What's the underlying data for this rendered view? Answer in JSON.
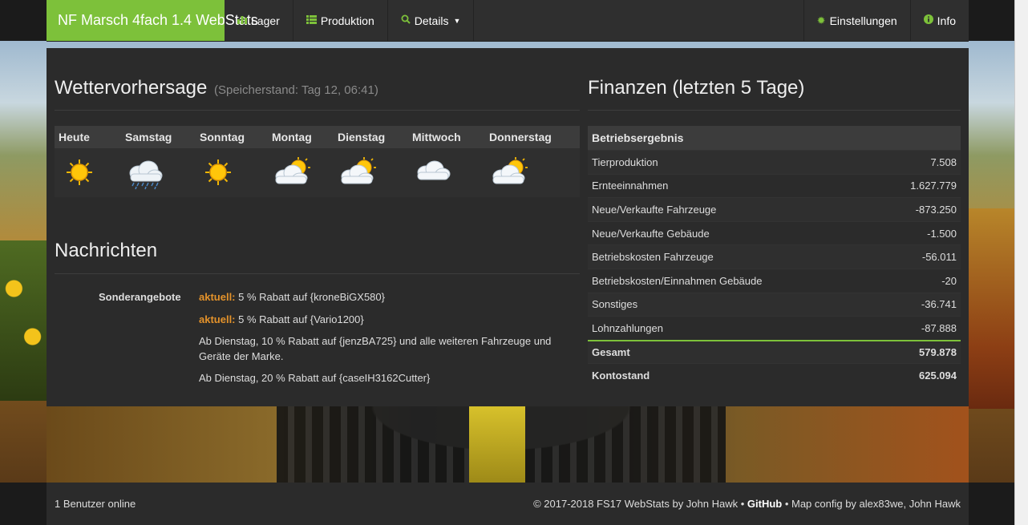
{
  "nav": {
    "brand": "NF Marsch 4fach 1.4 WebStats",
    "items": [
      {
        "label": "Lager",
        "icon": "bar-chart-icon"
      },
      {
        "label": "Produktion",
        "icon": "list-icon"
      },
      {
        "label": "Details",
        "icon": "search-icon"
      }
    ],
    "right": [
      {
        "label": "Einstellungen",
        "icon": "gear-icon"
      },
      {
        "label": "Info",
        "icon": "info-icon"
      }
    ]
  },
  "weather": {
    "title": "Wettervorhersage",
    "subtitle": "(Speicherstand: Tag 12, 06:41)",
    "days": [
      {
        "label": "Heute",
        "icon": "sun-icon"
      },
      {
        "label": "Samstag",
        "icon": "rain-icon"
      },
      {
        "label": "Sonntag",
        "icon": "sun-icon"
      },
      {
        "label": "Montag",
        "icon": "partly-cloudy-icon"
      },
      {
        "label": "Dienstag",
        "icon": "partly-cloudy-icon"
      },
      {
        "label": "Mittwoch",
        "icon": "cloud-icon"
      },
      {
        "label": "Donnerstag",
        "icon": "partly-cloudy-icon"
      }
    ]
  },
  "news": {
    "title": "Nachrichten",
    "label": "Sonderangebote",
    "items": [
      {
        "prefix": "aktuell:",
        "text": " 5 % Rabatt auf {kroneBiGX580}"
      },
      {
        "prefix": "aktuell:",
        "text": " 5 % Rabatt auf {Vario1200}"
      },
      {
        "prefix": "",
        "text": "Ab Dienstag, 10 % Rabatt auf {jenzBA725} und alle weiteren Fahrzeuge und Geräte der Marke."
      },
      {
        "prefix": "",
        "text": "Ab Dienstag, 20 % Rabatt auf {caseIH3162Cutter}"
      }
    ]
  },
  "finance": {
    "title": "Finanzen (letzten 5 Tage)",
    "header": "Betriebsergebnis",
    "rows": [
      {
        "label": "Tierproduktion",
        "value": "7.508"
      },
      {
        "label": "Ernteeinnahmen",
        "value": "1.627.779"
      },
      {
        "label": "Neue/Verkaufte Fahrzeuge",
        "value": "-873.250"
      },
      {
        "label": "Neue/Verkaufte Gebäude",
        "value": "-1.500"
      },
      {
        "label": "Betriebskosten Fahrzeuge",
        "value": "-56.011"
      },
      {
        "label": "Betriebskosten/Einnahmen Gebäude",
        "value": "-20"
      },
      {
        "label": "Sonstiges",
        "value": "-36.741"
      },
      {
        "label": "Lohnzahlungen",
        "value": "-87.888"
      }
    ],
    "total": {
      "label": "Gesamt",
      "value": "579.878"
    },
    "balance": {
      "label": "Kontostand",
      "value": "625.094"
    }
  },
  "footer": {
    "users": "1 Benutzer online",
    "copyright": "© 2017-2018 FS17 WebStats by John Hawk • ",
    "github": "GitHub",
    "mapconfig": " • Map config by alex83we, John Hawk"
  },
  "colors": {
    "accent": "#7dc13a",
    "highlight": "#e3922b",
    "panel": "#2b2b2b"
  }
}
